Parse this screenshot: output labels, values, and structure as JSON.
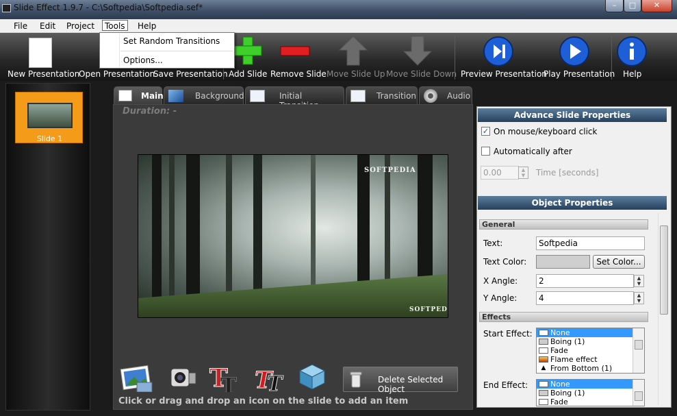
{
  "window": {
    "title": "Slide Effect 1.9.7 - C:\\Softpedia\\Softpedia.sef*",
    "minimize": "–",
    "maximize": "□",
    "close": "✕"
  },
  "menubar": {
    "file": "File",
    "edit": "Edit",
    "project": "Project",
    "tools": "Tools",
    "help": "Help"
  },
  "tools_menu": {
    "item1": "Set Random Transitions",
    "item2": "Options..."
  },
  "toolbar": {
    "new": "New Presentation",
    "open": "Open Presentation",
    "save": "Save Presentation",
    "add": "Add Slide",
    "remove": "Remove Slide",
    "up": "Move Slide Up",
    "down": "Move Slide Down",
    "preview": "Preview Presentation",
    "play": "Play Presentation",
    "help": "Help"
  },
  "slides": [
    {
      "label": "Slide 1"
    }
  ],
  "tabs": {
    "main": "Main",
    "background": "Background",
    "initial": "Initial Transition",
    "transition": "Transition",
    "audio": "Audio"
  },
  "main": {
    "duration": "Duration: -",
    "watermark_top": "SOFTPEDIA",
    "watermark_bottom": "SOFTPEDIA",
    "hint": "Click or drag and drop an icon on the slide to add an item",
    "delete_btn": "Delete Selected Object"
  },
  "advance": {
    "header": "Advance Slide Properties",
    "on_click": "On mouse/keyboard click",
    "on_click_checked": "✓",
    "auto_after": "Automatically after",
    "time_value": "0.00",
    "time_label": "Time [seconds]"
  },
  "object": {
    "header": "Object Properties",
    "general": "General",
    "text_label": "Text:",
    "text_value": "Softpedia",
    "color_label": "Text Color:",
    "set_color": "Set Color...",
    "x_label": "X Angle:",
    "x_value": "2",
    "y_label": "Y Angle:",
    "y_value": "4",
    "effects": "Effects",
    "start_label": "Start Effect:",
    "end_label": "End Effect:",
    "start_items": [
      "None",
      "Boing (1)",
      "Fade",
      "Flame effect",
      "From Bottom (1)"
    ],
    "end_items": [
      "None",
      "Boing (1)",
      "Fade"
    ]
  },
  "colors": {
    "accent_orange": "#f49b1a",
    "header_blue": "#25405e",
    "selection": "#3399ff"
  }
}
